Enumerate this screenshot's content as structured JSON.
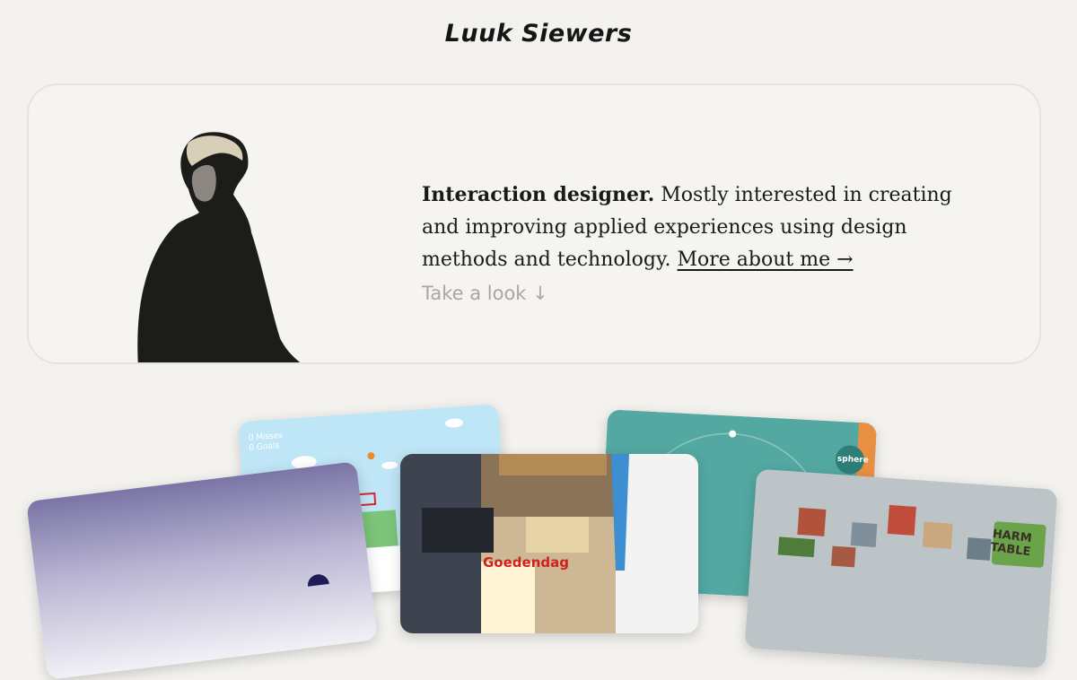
{
  "header": {
    "logo_text": "Luuk Siewers"
  },
  "hero": {
    "intro_bold": "Interaction designer.",
    "intro_rest": " Mostly interested in creating and improving applied experiences using design methods and technology. ",
    "about_link": "More about me →",
    "take_a_look": "Take a look ↓"
  },
  "projects": {
    "game": {
      "line1": "0 Misses",
      "line2": "0 Goals"
    },
    "teal": {
      "badge": "sphere"
    },
    "supermarket": {
      "sign": "Goedendag"
    },
    "harm": {
      "line1": "HARM",
      "line2": "TABLE"
    }
  },
  "colors": {
    "background": "#f4f2ee",
    "hero_border": "#e6e3df",
    "muted_text": "#aaa7a2",
    "teal_card": "#54a8a2",
    "sky_card": "#bfe6f6",
    "purple_card": "#7a75a6"
  }
}
